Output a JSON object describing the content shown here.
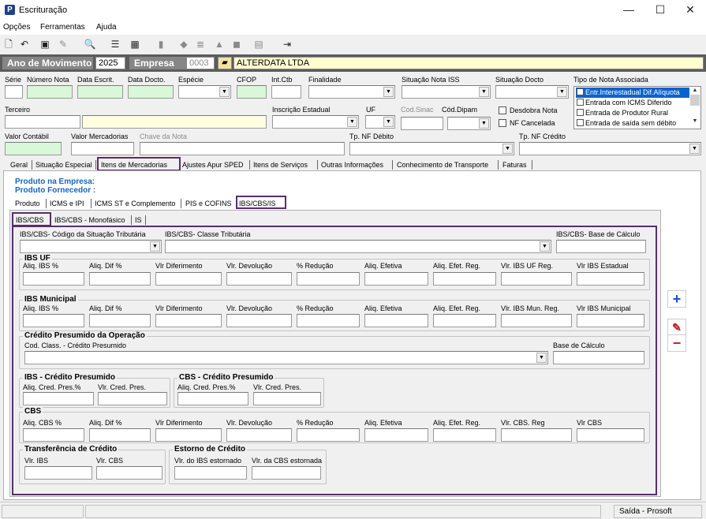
{
  "window": {
    "title": "Escrituração",
    "app_icon": "P",
    "min": "—",
    "max": "☐",
    "close": "✕"
  },
  "menu": [
    "Opções",
    "Ferramentas",
    "Ajuda"
  ],
  "toolbar_icons": [
    "new-doc-icon",
    "undo-icon",
    "save-icon",
    "brush-icon",
    "preview-icon",
    "list-icon",
    "calc-icon",
    "folder-icon",
    "stamp-icon",
    "book-icon",
    "cart-icon",
    "cub-icon",
    "sheet-icon",
    "exit-icon"
  ],
  "header": {
    "ano_label": "Ano de Movimento",
    "ano_value": "2025",
    "empresa_label": "Empresa",
    "empresa_code": "0003",
    "empresa_name": "ALTERDATA LTDA"
  },
  "row1_labels": {
    "serie": "Série",
    "numero": "Número Nota",
    "data_escrit": "Data Escrit.",
    "data_docto": "Data Docto.",
    "especie": "Espécie",
    "cfop": "CFOP",
    "int_ctb": "Int.Ctb",
    "finalidade": "Finalidade",
    "situacao_iss": "Situação Nota ISS",
    "situacao_docto": "Situação Docto",
    "tipo_nota": "Tipo de Nota Associada"
  },
  "row2_labels": {
    "terceiro": "Terceiro",
    "inscricao": "Inscrição Estadual",
    "uf": "UF",
    "cod_sinac": "Cod.Sinac",
    "cod_dipam": "Cód.Dipam",
    "desdobra": "Desdobra Nota",
    "nf_cancelada": "NF Cancelada"
  },
  "row3_labels": {
    "valor_contabil": "Valor Contábil",
    "valor_mercadorias": "Valor Mercadorias",
    "chave": "Chave da Nota",
    "tp_debito": "Tp. NF Débito",
    "tp_credito": "Tp. NF Crédito"
  },
  "tipo_nota_items": [
    "Entr.Interestadual Dif.Alíquota",
    "Entrada com ICMS Diferido",
    "Entrada de Produtor Rural",
    "Entrada de saída sem débito"
  ],
  "main_tabs": [
    "Geral",
    "Situação Especial",
    "Itens de Mercadorias",
    "Ajustes Apur SPED",
    "Itens de Serviços",
    "Outras Informações",
    "Conhecimento de Transporte",
    "Faturas"
  ],
  "produto": {
    "empresa_label": "Produto na Empresa:",
    "fornecedor_label": "Produto Fornecedor :"
  },
  "sub_tabs": [
    "Produto",
    "ICMS e IPI",
    "ICMS ST e Complemento",
    "PIS e COFINS",
    "IBS/CBS/IS"
  ],
  "inner_tabs": [
    "IBS/CBS",
    "IBS/CBS - Monofásico",
    "IS"
  ],
  "ibscbs": {
    "cst_label": "IBS/CBS- Código da Situação Tributária",
    "classe_label": "IBS/CBS- Classe Tributária",
    "base_label": "IBS/CBS- Base de Cálculo"
  },
  "ibs_uf": {
    "title": "IBS UF",
    "cols": [
      "Aliq. IBS %",
      "Aliq. Dif %",
      "Vlr Diferimento",
      "Vlr. Devolução",
      "% Redução",
      "Aliq. Efetiva",
      "Aliq. Efet. Reg.",
      "Vlr. IBS UF Reg.",
      "Vlr IBS Estadual"
    ]
  },
  "ibs_mun": {
    "title": "IBS Municipal",
    "cols": [
      "Aliq. IBS %",
      "Aliq. Dif %",
      "Vlr Diferimento",
      "Vlr. Devolução",
      "% Redução",
      "Aliq. Efetiva",
      "Aliq. Efet. Reg.",
      "Vlr. IBS Mun. Reg.",
      "Vlr IBS Municipal"
    ]
  },
  "credito": {
    "title": "Crédito Presumido da Operação",
    "cod_label": "Cod. Class. - Crédito Presumido",
    "base_label": "Base de Cálculo"
  },
  "ibs_cred": {
    "title": "IBS - Crédito Presumido",
    "cols": [
      "Aliq. Cred. Pres.%",
      "Vlr. Cred. Pres."
    ]
  },
  "cbs_cred": {
    "title": "CBS - Crédito Presumido",
    "cols": [
      "Aliq. Cred. Pres.%",
      "Vlr. Cred. Pres."
    ]
  },
  "cbs": {
    "title": "CBS",
    "cols": [
      "Aliq. CBS %",
      "Aliq. Dif %",
      "Vlr Diferimento",
      "Vlr. Devolução",
      "% Redução",
      "Aliq. Efetiva",
      "Aliq. Efet. Reg.",
      "Vlr. CBS. Reg",
      "Vlr CBS"
    ]
  },
  "transf": {
    "title": "Transferência de Crédito",
    "cols": [
      "Vlr. IBS",
      "Vlr. CBS"
    ]
  },
  "estorno": {
    "title": "Estorno de Crédito",
    "cols": [
      "Vlr. do IBS estornado",
      "Vlr. da CBS estornada"
    ]
  },
  "side": {
    "add": "+",
    "edit": "✎",
    "remove": "−"
  },
  "status": {
    "right": "Saída - Prosoft"
  },
  "colors": {
    "accent_border": "#5a2d6e",
    "header_dark": "#5c5c5c",
    "field_green": "#d9f7d9",
    "field_yellow": "#ffffe0",
    "link_blue": "#1565c0"
  }
}
